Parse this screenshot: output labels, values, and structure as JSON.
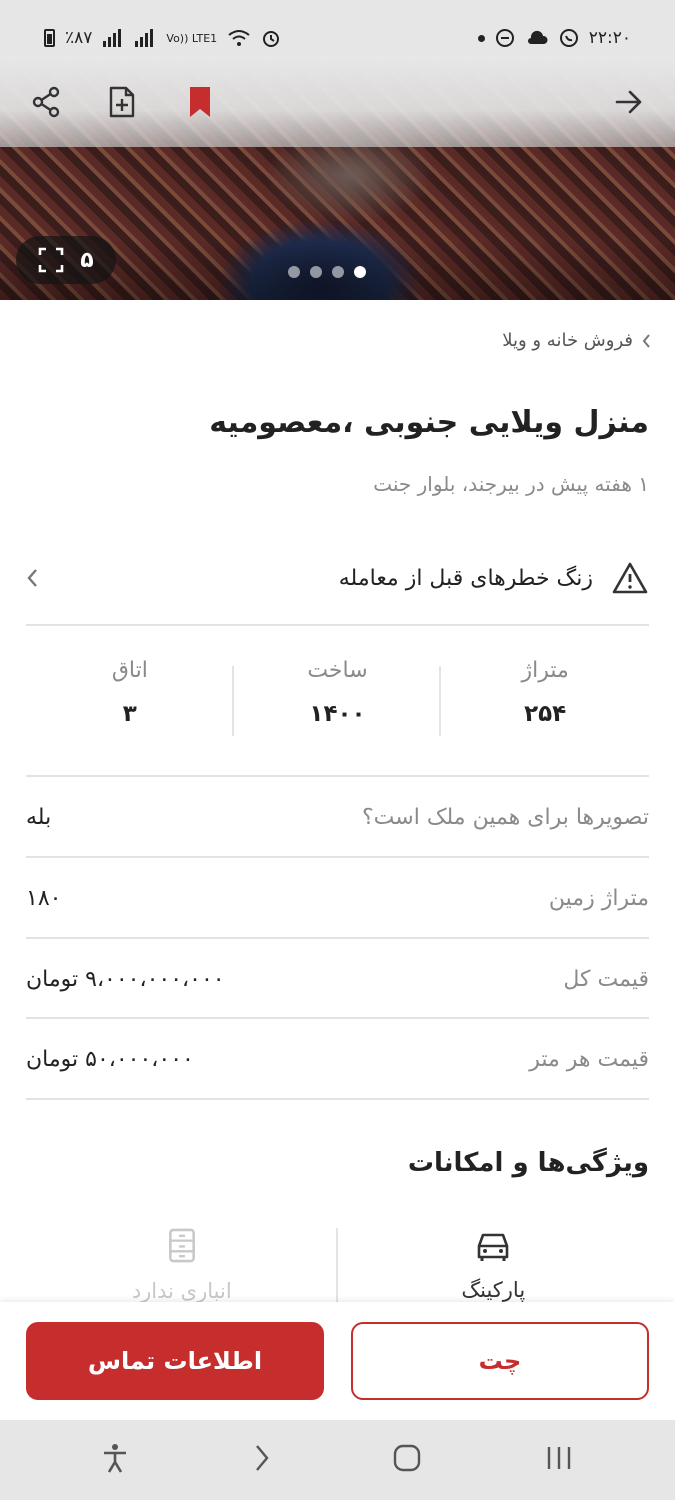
{
  "status_bar": {
    "time": "۲۲:۲۰",
    "battery": "٪۸۷",
    "network": "Vo)) LTE1"
  },
  "hero": {
    "photo_count": "۵",
    "dots_total": 4,
    "dot_active_index": 3
  },
  "topbar": {
    "icons": [
      "back-arrow-icon",
      "bookmark-icon",
      "add-note-icon",
      "share-icon"
    ],
    "bookmark_color": "#c62d2d"
  },
  "breadcrumb": {
    "label": "فروش خانه و ویلا"
  },
  "listing": {
    "title": "منزل ویلایی جنوبی ،معصومیه",
    "subtitle": "۱ هفته پیش در بیرجند، بلوار جنت"
  },
  "warning": {
    "label": "زنگ خطرهای قبل از معامله"
  },
  "stats": [
    {
      "key": "متراژ",
      "value": "۲۵۴"
    },
    {
      "key": "ساخت",
      "value": "۱۴۰۰"
    },
    {
      "key": "اتاق",
      "value": "۳"
    }
  ],
  "details": [
    {
      "key": "تصویرها برای همین ملک است؟",
      "value": "بله"
    },
    {
      "key": "متراژ زمین",
      "value": "۱۸۰"
    },
    {
      "key": "قیمت کل",
      "value": "۹،۰۰۰،۰۰۰،۰۰۰ تومان"
    },
    {
      "key": "قیمت هر متر",
      "value": "۵۰،۰۰۰،۰۰۰ تومان"
    }
  ],
  "features": {
    "title": "ویژگی‌ها و امکانات",
    "items": [
      {
        "label": "پارکینگ",
        "icon": "car-icon",
        "available": true
      },
      {
        "label": "انباری ندارد",
        "icon": "storage-icon",
        "available": false
      }
    ]
  },
  "actions": {
    "contact_label": "اطلاعات تماس",
    "chat_label": "چت",
    "accent": "#c62d2d"
  }
}
